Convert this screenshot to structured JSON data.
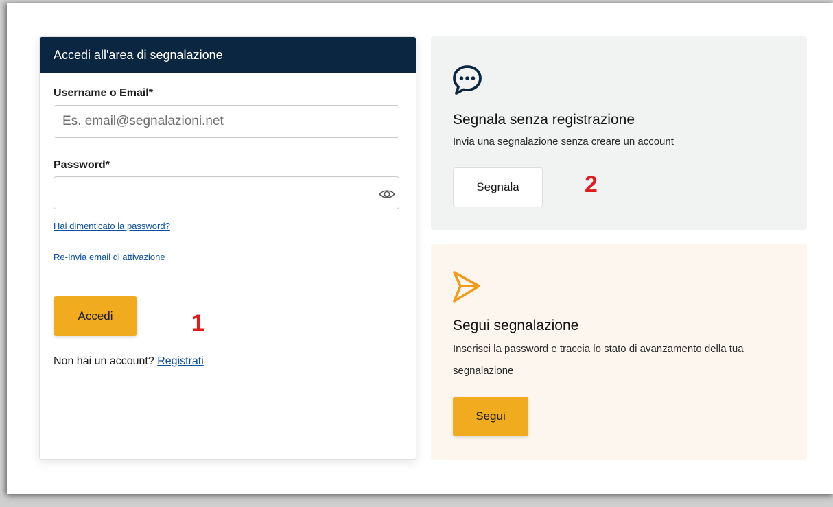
{
  "login": {
    "header": "Accedi all'area di segnalazione",
    "username_label": "Username o Email*",
    "username_placeholder": "Es. email@segnalazioni.net",
    "username_value": "",
    "password_label": "Password*",
    "password_value": "",
    "forgot_link": "Hai dimenticato la password?",
    "resend_link": "Re-Invia email di attivazione",
    "submit_label": "Accedi",
    "no_account_text": "Non hai un account? ",
    "register_link": "Registrati"
  },
  "annotations": [
    "1",
    "2"
  ],
  "report_card": {
    "icon": "chat-bubble-icon",
    "title": "Segnala senza registrazione",
    "description": "Invia una segnalazione senza creare un account",
    "button_label": "Segnala"
  },
  "follow_card": {
    "icon": "paper-plane-icon",
    "title": "Segui segnalazione",
    "description": "Inserisci la password e traccia lo stato di avanzamento della tua segnalazione",
    "button_label": "Segui"
  },
  "colors": {
    "header_bg": "#0b2640",
    "accent_yellow": "#f0ac1e",
    "link": "#0b4fa0",
    "annotation_red": "#e01a1a",
    "grey_card": "#f1f2f2",
    "beige_card": "#fcf6ee",
    "plane_orange": "#f29a1a"
  }
}
